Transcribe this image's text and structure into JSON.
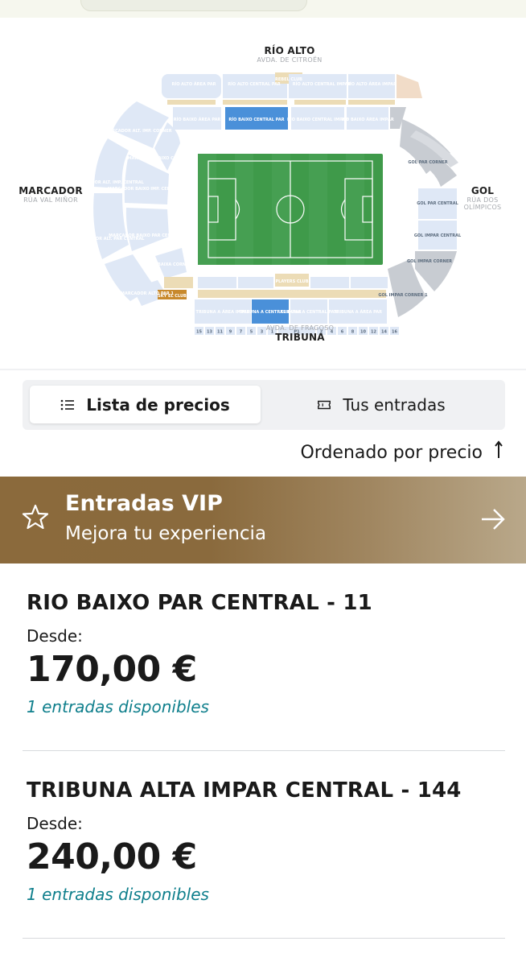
{
  "map": {
    "top_label": "RÍO ALTO",
    "top_sub": "AVDA. DE CITROËN",
    "left_label": "MARCADOR",
    "left_sub": "RÚA VAL MIÑOR",
    "right_label": "GOL",
    "right_sub_1": "RÚA DOS",
    "right_sub_2": "OLÍMPICOS",
    "bottom_sub": "AVDA. DE FRAGOSO",
    "bottom_label": "TRIBUNA",
    "sections": {
      "rio_alto_area_par": "RÍO ALTO ÁREA PAR",
      "rio_alto_central_par": "RÍO ALTO CENTRAL PAR",
      "rio_alto_central_impar": "RÍO ALTO CENTRAL IMPAR",
      "rio_alto_area_impar": "RÍO ALTO ÁREA IMPAR",
      "rio_baixo_central_par": "RÍO BAIXO CENTRAL PAR",
      "rio_baixo_area_par": "RÍO BAIXO ÁREA PAR",
      "rio_baixo_central_impar": "RÍO BAIXO CENTRAL IMPAR",
      "rio_baixo_area_impar": "RÍO BAIXO ÁREA IMPAR",
      "marcador_alt_impar_corner": "MARCADOR ALT. IMP. CORNER",
      "marcador_baixo_corner": "MARCADOR BAIXO CORNER",
      "marcador_alt_impar_central": "MARCADOR ALT. IMP. CENTRAL",
      "marcador_baixo_impar_central": "MARCADOR BAIXO IMP. CENTRAL",
      "marcador_alt_par_central": "MARCADOR ALT. PAR CENTRAL",
      "marcador_baixo_par_central": "MARCADOR BAIXO PAR CENTRAL",
      "t_baixa_corner": "T. BAIXA CORNER",
      "marcador_alto_par_1": "MARCADOR ALTO PAR 1",
      "gol_par_corner": "GOL PAR CORNER",
      "gol_par_central": "GOL PAR CENTRAL",
      "gol_impar_central": "GOL IMPAR CENTRAL",
      "gol_impar_corner": "GOL IMPAR CORNER",
      "gol_impar_corner_1": "GOL IMPAR CORNER 1",
      "tribuna_a_area_impar": "TRIBUNA A ÁREA IMPAR",
      "tribuna_a_central_impar": "TRIBUNA A CENTRAL IMPAR",
      "tribuna_a_central_par": "TRIBUNA A CENTRAL PAR",
      "tribuna_a_area_par": "TRIBUNA A ÁREA PAR",
      "players_club": "PLAYERS CLUB",
      "sky_el_club": "SKY EL CLUB",
      "rebel_club": "REBEL CLUB"
    },
    "boxes_left": [
      "15",
      "13",
      "11",
      "9",
      "7",
      "5",
      "3",
      "1"
    ],
    "box_mid": "P1",
    "boxes_right": [
      "2",
      "4",
      "6",
      "8",
      "10",
      "12",
      "14",
      "16"
    ]
  },
  "tabs": {
    "price_list": "Lista de precios",
    "your_tickets": "Tus entradas"
  },
  "sort_label": "Ordenado por precio",
  "vip": {
    "title": "Entradas VIP",
    "subtitle": "Mejora tu experiencia"
  },
  "listings": [
    {
      "name": "RIO BAIXO PAR CENTRAL - 11",
      "from_label": "Desde:",
      "price": "170,00 €",
      "availability": "1 entradas disponibles"
    },
    {
      "name": "TRIBUNA ALTA IMPAR CENTRAL - 144",
      "from_label": "Desde:",
      "price": "240,00 €",
      "availability": "1 entradas disponibles"
    }
  ],
  "colors": {
    "section_light": "#dfe8f6",
    "section_selected": "#4a90d9",
    "section_gold": "#ecdcb6",
    "section_gray": "#d8dbe0",
    "pitch": "#3f9a4a",
    "availability": "#0f7f8c",
    "vip_gold": "#8b6a3c"
  }
}
